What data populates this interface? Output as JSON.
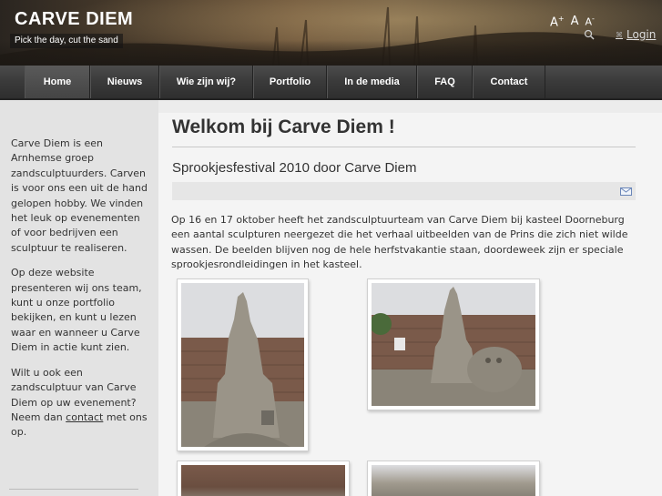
{
  "site": {
    "title": "CARVE DIEM",
    "tagline": "Pick the day, cut the sand"
  },
  "header": {
    "font_sizes": {
      "increase": "A",
      "increase_sup": "+",
      "normal": "A",
      "decrease": "A",
      "decrease_sup": "-"
    },
    "search_icon": "search-icon",
    "login_label": "Login"
  },
  "nav": {
    "items": [
      {
        "label": "Home",
        "active": true
      },
      {
        "label": "Nieuws"
      },
      {
        "label": "Wie zijn wij?"
      },
      {
        "label": "Portfolio"
      },
      {
        "label": "In de media"
      },
      {
        "label": "FAQ"
      },
      {
        "label": "Contact"
      }
    ]
  },
  "sidebar": {
    "p1": "Carve Diem is een Arnhemse groep zandsculptuurders. Carven is voor ons een uit de hand gelopen hobby. We vinden het leuk op evenementen of voor bedrijven een sculptuur te realiseren.",
    "p2": "Op deze website presenteren wij ons team, kunt u onze portfolio bekijken, en kunt u lezen waar en wanneer u Carve Diem in actie kunt zien.",
    "p3_before": "Wilt u ook een zandsculptuur van Carve Diem op uw evenement? Neem dan ",
    "p3_link": "contact",
    "p3_after": " met ons op."
  },
  "main": {
    "page_title": "Welkom bij Carve Diem !",
    "article_title": "Sprookjesfestival 2010 door Carve Diem",
    "mail_icon": "mail-icon",
    "article_text": "Op 16 en 17 oktober heeft het zandsculptuurteam van Carve Diem bij kasteel Doorneburg een aantal sculpturen neergezet die het verhaal uitbeelden van de Prins die zich niet wilde wassen. De beelden blijven nog de hele herfstvakantie staan, doordeweek zijn er speciale sprookjesrondleidingen in het kasteel."
  },
  "colors": {
    "nav_bg": "#3a3a3a",
    "sidebar_bg": "#e3e3e3",
    "main_bg": "#f4f4f4",
    "text": "#333333"
  }
}
